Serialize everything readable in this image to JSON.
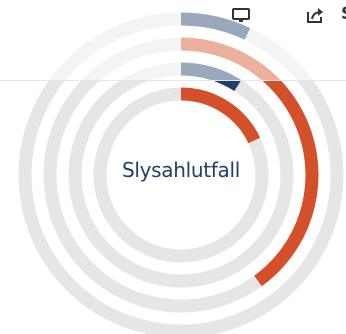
{
  "chart_data": {
    "type": "radial-bar",
    "center_label": "Slysahlutfall",
    "track_color": "#e6e6e6",
    "rings": [
      {
        "color": "#d4502a",
        "fraction": 0.18
      },
      {
        "color": "#1f3f6c",
        "fraction": 0.09
      },
      {
        "color": "#d4502a",
        "fraction": 0.4
      },
      {
        "color": "#1f3f6c",
        "fraction": 0.07
      }
    ]
  },
  "toolbar": {
    "share_label": "S",
    "present_icon": "monitor-icon",
    "share_icon": "share-icon"
  },
  "colors": {
    "orange": "#d4502a",
    "navy": "#1f3f6c",
    "track": "#e6e6e6",
    "icon": "#333333"
  }
}
